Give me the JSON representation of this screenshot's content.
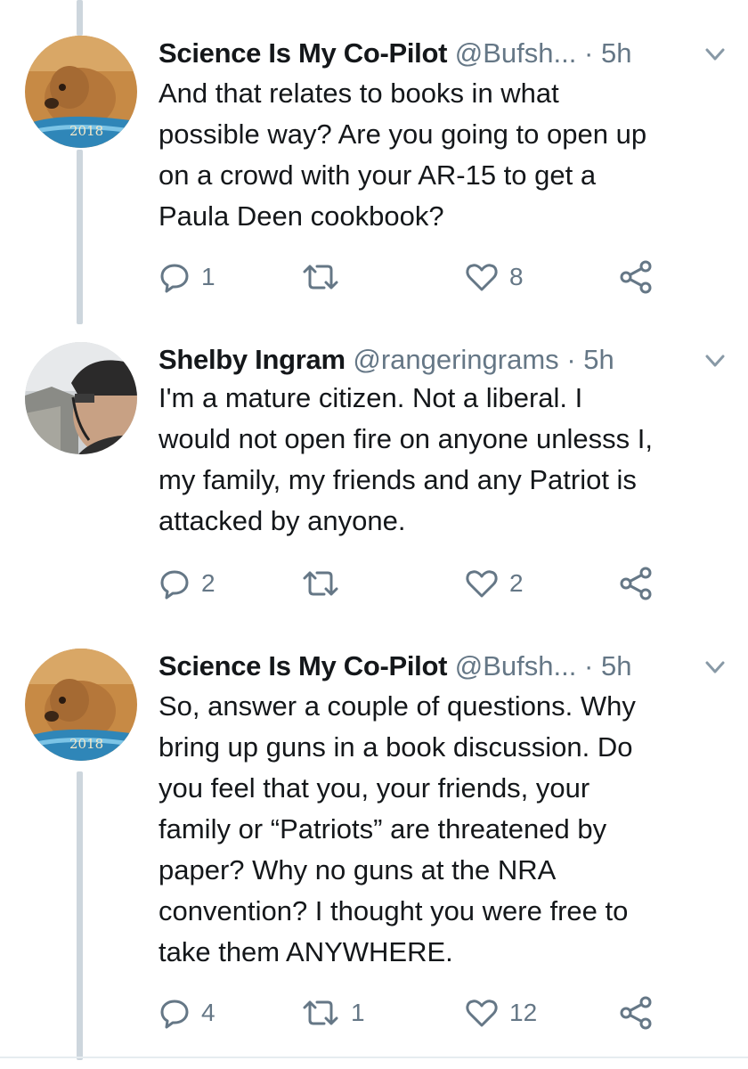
{
  "tweets": [
    {
      "name": "Science Is My Co-Pilot",
      "handle": "@Bufsh...",
      "dot": "·",
      "time": "5h",
      "avatar_badge": "2018",
      "lines": [
        "And that relates to books in what",
        "possible way?  Are you going to open up",
        "on a crowd with your AR-15 to get a",
        "Paula Deen cookbook?"
      ],
      "replies": "1",
      "retweets": "",
      "likes": "8"
    },
    {
      "name": "Shelby Ingram",
      "handle": "@rangeringrams",
      "dot": "·",
      "time": "5h",
      "lines": [
        "I'm a mature citizen.  Not a liberal.  I",
        "would not open fire on anyone unlesss I,",
        "my family, my friends and any Patriot is",
        "attacked by anyone."
      ],
      "replies": "2",
      "retweets": "",
      "likes": "2"
    },
    {
      "name": "Science Is My Co-Pilot",
      "handle": "@Bufsh...",
      "dot": "·",
      "time": "5h",
      "avatar_badge": "2018",
      "lines": [
        "So, answer a couple of questions. Why",
        "bring up guns in a book discussion. Do",
        "you feel that you, your friends, your",
        "family or “Patriots” are threatened by",
        "paper? Why no guns at the NRA",
        "convention? I thought you were free to",
        "take them ANYWHERE."
      ],
      "replies": "4",
      "retweets": "1",
      "likes": "12"
    }
  ],
  "colors": {
    "text": "#14171a",
    "secondary": "#657786",
    "thread_line": "#cdd6dd"
  },
  "icons": [
    "reply-icon",
    "retweet-icon",
    "like-icon",
    "share-icon",
    "chevron-down-icon"
  ]
}
